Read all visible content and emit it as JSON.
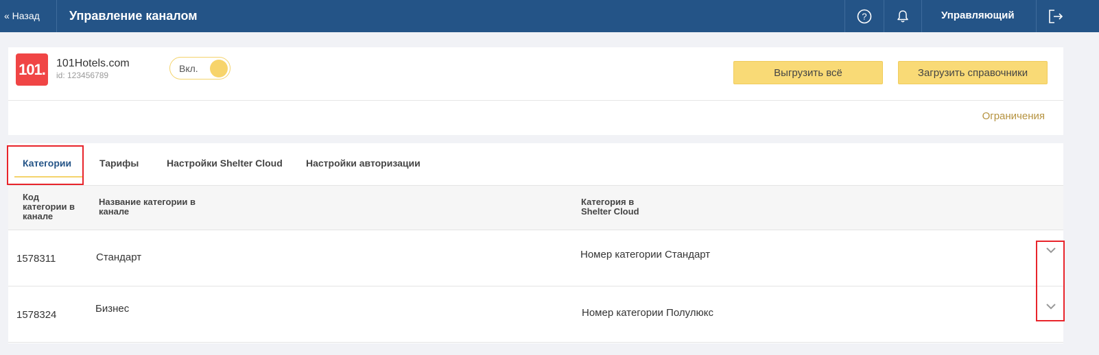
{
  "header": {
    "back_label": "« Назад",
    "title": "Управление каналом",
    "help_icon": "question-circle-icon",
    "notifications_icon": "bell-icon",
    "user_label": "Управляющий",
    "logout_icon": "logout-icon"
  },
  "channel": {
    "logo_text": "101.",
    "name": "101Hotels.com",
    "id_text": "id: 123456789",
    "toggle_label": "Вкл.",
    "toggle_on": true,
    "export_all_label": "Выгрузить всё",
    "load_refs_label": "Загрузить справочники",
    "limits_label": "Ограничения"
  },
  "tabs": [
    {
      "label": "Категории",
      "active": true
    },
    {
      "label": "Тарифы",
      "active": false
    },
    {
      "label": "Настройки Shelter Cloud",
      "active": false
    },
    {
      "label": "Настройки авторизации",
      "active": false
    }
  ],
  "table": {
    "columns": [
      "Код категории в канале",
      "Название категории в канале",
      "Категория в Shelter Cloud"
    ],
    "rows": [
      {
        "code": "1578311",
        "name": "Стандарт",
        "shelter_category": "Номер категории Стандарт"
      },
      {
        "code": "1578324",
        "name": "Бизнес",
        "shelter_category": "Номер категории Полулюкс"
      }
    ]
  },
  "colors": {
    "header_bg": "#245487",
    "accent_yellow": "#f9da76",
    "logo_red": "#f04545",
    "limits_link": "#b5923f",
    "highlight_red": "#e8232a"
  }
}
